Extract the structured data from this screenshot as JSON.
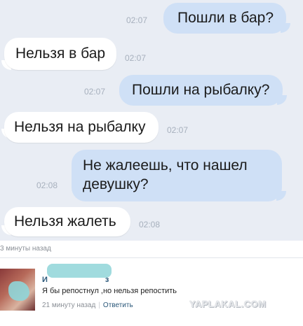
{
  "chat": {
    "messages": [
      {
        "side": "out",
        "text": "Пошли в бар?",
        "time": "02:07"
      },
      {
        "side": "in",
        "text": "Нельзя в бар",
        "time": "02:07"
      },
      {
        "side": "out",
        "text": "Пошли на рыбалку?",
        "time": "02:07"
      },
      {
        "side": "in",
        "text": "Нельзя на рыбалку",
        "time": "02:07"
      },
      {
        "side": "out",
        "text_line1": "Не жалеешь, что нашел",
        "text_line2": "девушку?",
        "time": "02:08"
      },
      {
        "side": "in",
        "text": "Нельзя жалеть",
        "time": "02:08"
      }
    ]
  },
  "post": {
    "time_ago": "3 минуты назад"
  },
  "comment": {
    "author_visible": "И",
    "author_tail": "з",
    "text": "Я бы репостнул ,но нельзя репостить",
    "time_ago": "21 минуту назад",
    "separator": "|",
    "reply_label": "Ответить"
  },
  "watermark": "YAPLAKAL.COM",
  "colors": {
    "chat_background": "#e9edf4",
    "incoming_bubble": "#ffffff",
    "outgoing_bubble": "#cfe0f6",
    "link": "#2b587a"
  }
}
